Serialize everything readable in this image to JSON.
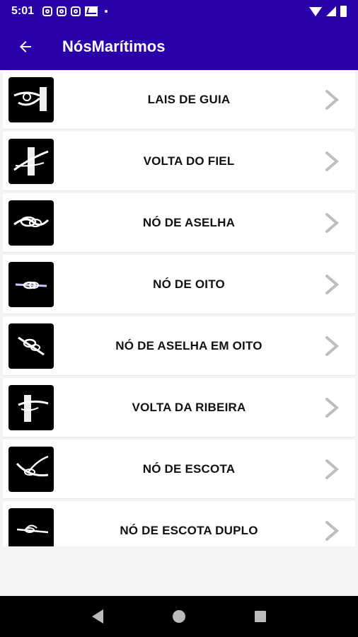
{
  "status_bar": {
    "time": "5:01"
  },
  "app_bar": {
    "title": "NósMarítimos"
  },
  "items": [
    {
      "label": "LAIS DE GUIA"
    },
    {
      "label": "VOLTA DO FIEL"
    },
    {
      "label": "NÓ DE ASELHA"
    },
    {
      "label": "NÓ DE OITO"
    },
    {
      "label": "NÓ DE ASELHA EM OITO"
    },
    {
      "label": "VOLTA DA RIBEIRA"
    },
    {
      "label": "NÓ DE ESCOTA"
    },
    {
      "label": "NÓ DE ESCOTA DUPLO"
    }
  ],
  "colors": {
    "primary": "#2a00a8",
    "background": "#f4f4f4",
    "chevron": "#bdbdbd"
  },
  "icons": {
    "back": "arrow-left-icon",
    "chevron": "chevron-right-icon"
  }
}
